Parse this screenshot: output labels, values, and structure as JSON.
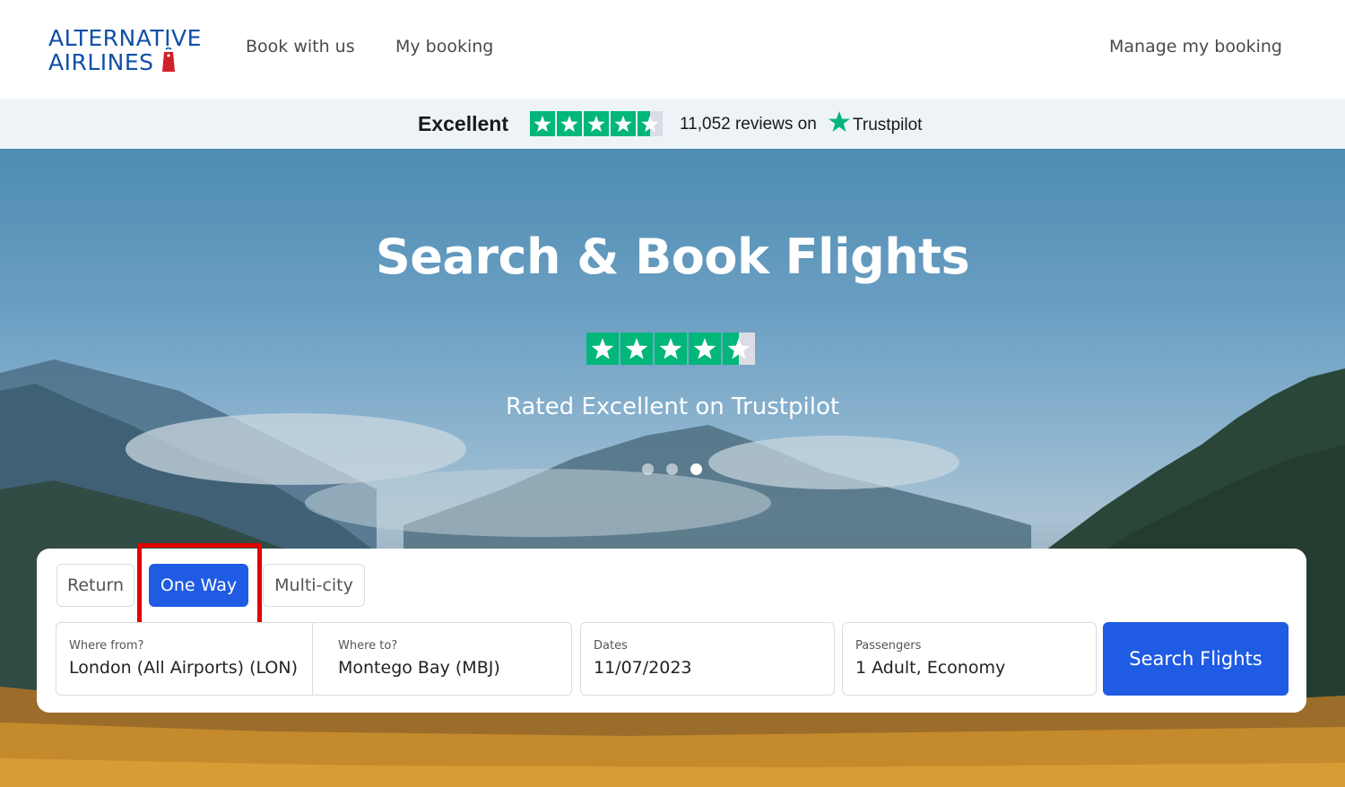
{
  "header": {
    "logo_line1": "ALTERNATIVE",
    "logo_line2": "AIRLINES",
    "nav": {
      "book_with_us": "Book with us",
      "my_booking": "My booking",
      "manage_my_booking": "Manage my booking"
    }
  },
  "trustpilot_bar": {
    "rating_word": "Excellent",
    "reviews_text": "11,052 reviews on",
    "brand": "Trustpilot",
    "star_rating": 4.5,
    "max_stars": 5
  },
  "hero": {
    "title": "Search & Book Flights",
    "subtitle": "Rated Excellent on Trustpilot",
    "star_rating": 4.5,
    "carousel": {
      "count": 3,
      "active_index": 3
    }
  },
  "search": {
    "trip_types": {
      "return": "Return",
      "one_way": "One Way",
      "multi_city": "Multi-city",
      "selected": "One Way"
    },
    "from": {
      "label": "Where from?",
      "value": "London (All Airports) (LON)"
    },
    "to": {
      "label": "Where to?",
      "value": "Montego Bay (MBJ)"
    },
    "dates": {
      "label": "Dates",
      "value": "11/07/2023"
    },
    "passengers": {
      "label": "Passengers",
      "value": "1 Adult, Economy"
    },
    "search_button": "Search Flights"
  },
  "colors": {
    "brand_blue": "#0f4fa8",
    "primary_button": "#1f5be3",
    "trustpilot_green": "#00b67a",
    "highlight_red": "#e10000"
  },
  "icons": {
    "logo_tag": "luggage-tag-icon",
    "star": "star-icon"
  }
}
